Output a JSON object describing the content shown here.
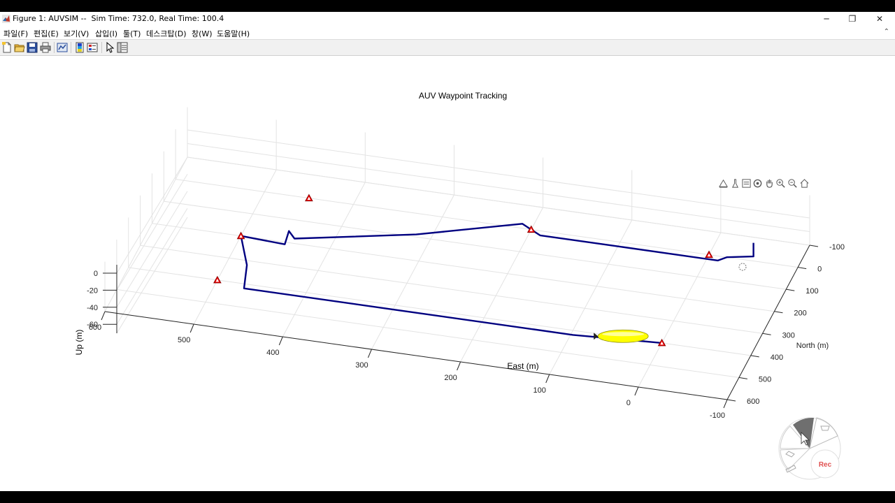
{
  "window": {
    "title": "Figure 1: AUVSIM --  Sim Time: 732.0, Real Time: 100.4",
    "minimize_glyph": "─",
    "maximize_glyph": "❐",
    "close_glyph": "✕"
  },
  "menu": {
    "items": [
      {
        "label": "파일(F)"
      },
      {
        "label": "편집(E)"
      },
      {
        "label": "보기(V)"
      },
      {
        "label": "삽입(I)"
      },
      {
        "label": "툴(T)"
      },
      {
        "label": "데스크탑(D)"
      },
      {
        "label": "창(W)"
      },
      {
        "label": "도움말(H)"
      }
    ],
    "collapse_glyph": "⌃"
  },
  "toolbar": {
    "icons": [
      "new-figure-icon",
      "open-file-icon",
      "save-icon",
      "print-icon",
      "link-plot-icon",
      "insert-colorbar-icon",
      "insert-legend-icon",
      "edit-plot-icon",
      "property-inspector-icon"
    ]
  },
  "axes_toolbar": {
    "icons": [
      "export-icon",
      "brush-icon",
      "datatips-icon",
      "rotate-3d-icon",
      "pan-icon",
      "zoom-in-icon",
      "zoom-out-icon",
      "restore-view-icon"
    ]
  },
  "chart_data": {
    "type": "line",
    "projection": "3d",
    "title": "AUV Waypoint Tracking",
    "xlabel": "East (m)",
    "ylabel": "North (m)",
    "zlabel": "Up (m)",
    "x_ticks": [
      "600",
      "500",
      "400",
      "300",
      "200",
      "100",
      "0",
      "-100"
    ],
    "y_ticks": [
      "-100",
      "0",
      "100",
      "200",
      "300",
      "400",
      "500",
      "600"
    ],
    "z_ticks": [
      "0",
      "-20",
      "-40",
      "-60"
    ],
    "xlim": [
      -100,
      600
    ],
    "ylim": [
      -100,
      600
    ],
    "zlim": [
      -70,
      15
    ],
    "grid": true,
    "series": [
      {
        "marker": "triangle",
        "color": "#ff0000",
        "points": [
          [
            0,
            0,
            0
          ],
          [
            200,
            0,
            0
          ],
          [
            450,
            0,
            0
          ],
          [
            500,
            200,
            0
          ],
          [
            500,
            400,
            0
          ],
          [
            0,
            400,
            0
          ]
        ]
      },
      {
        "line_color": "#000080",
        "color": "#000080",
        "points": [
          [
            -50,
            0,
            20
          ],
          [
            -50,
            0,
            5
          ],
          [
            -20,
            0,
            0
          ],
          [
            -10,
            0,
            -5
          ],
          [
            100,
            0,
            -5
          ],
          [
            190,
            0,
            -5
          ],
          [
            200,
            0,
            0
          ],
          [
            210,
            0,
            5
          ],
          [
            320,
            70,
            -5
          ],
          [
            445,
            160,
            -5
          ],
          [
            450,
            170,
            5
          ],
          [
            452,
            190,
            -5
          ],
          [
            500,
            200,
            0
          ],
          [
            480,
            300,
            -5
          ],
          [
            470,
            400,
            -5
          ],
          [
            300,
            400,
            -5
          ],
          [
            100,
            400,
            -5
          ],
          [
            0,
            400,
            0
          ]
        ]
      }
    ],
    "vehicle": {
      "name": "auv-model",
      "color": "#ffff00"
    }
  },
  "recorder": {
    "rec_label": "Rec"
  }
}
